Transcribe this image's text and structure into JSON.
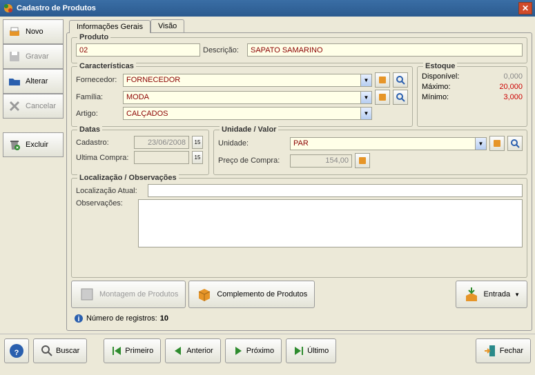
{
  "title": "Cadastro de Produtos",
  "sidebar": {
    "novo": "Novo",
    "gravar": "Gravar",
    "alterar": "Alterar",
    "cancelar": "Cancelar",
    "excluir": "Excluir"
  },
  "tabs": {
    "gerais": "Informações Gerais",
    "visao": "Visão"
  },
  "produto": {
    "legend": "Produto",
    "codigo": "02",
    "descricao_lbl": "Descrição:",
    "descricao": "SAPATO SAMARINO"
  },
  "caracteristicas": {
    "legend": "Características",
    "fornecedor_lbl": "Fornecedor:",
    "fornecedor": "FORNECEDOR",
    "familia_lbl": "Família:",
    "familia": "MODA",
    "artigo_lbl": "Artigo:",
    "artigo": "CALÇADOS"
  },
  "estoque": {
    "legend": "Estoque",
    "disponivel_lbl": "Disponível:",
    "disponivel": "0,000",
    "maximo_lbl": "Máximo:",
    "maximo": "20,000",
    "minimo_lbl": "Mínimo:",
    "minimo": "3,000"
  },
  "datas": {
    "legend": "Datas",
    "cadastro_lbl": "Cadastro:",
    "cadastro": "23/06/2008",
    "ultima_lbl": "Ultima Compra:"
  },
  "unidade": {
    "legend": "Unidade / Valor",
    "unidade_lbl": "Unidade:",
    "unidade": "PAR",
    "preco_lbl": "Preço de Compra:",
    "preco": "154,00"
  },
  "loc": {
    "legend": "Localização / Observações",
    "atual_lbl": "Localização Atual:",
    "obs_lbl": "Observações:"
  },
  "actions": {
    "montagem": "Montagem de Produtos",
    "complemento": "Complemento de Produtos",
    "entrada": "Entrada"
  },
  "info": {
    "registros_lbl": "Número de registros:",
    "registros": "10"
  },
  "footer": {
    "buscar": "Buscar",
    "primeiro": "Primeiro",
    "anterior": "Anterior",
    "proximo": "Próximo",
    "ultimo": "Último",
    "fechar": "Fechar"
  }
}
